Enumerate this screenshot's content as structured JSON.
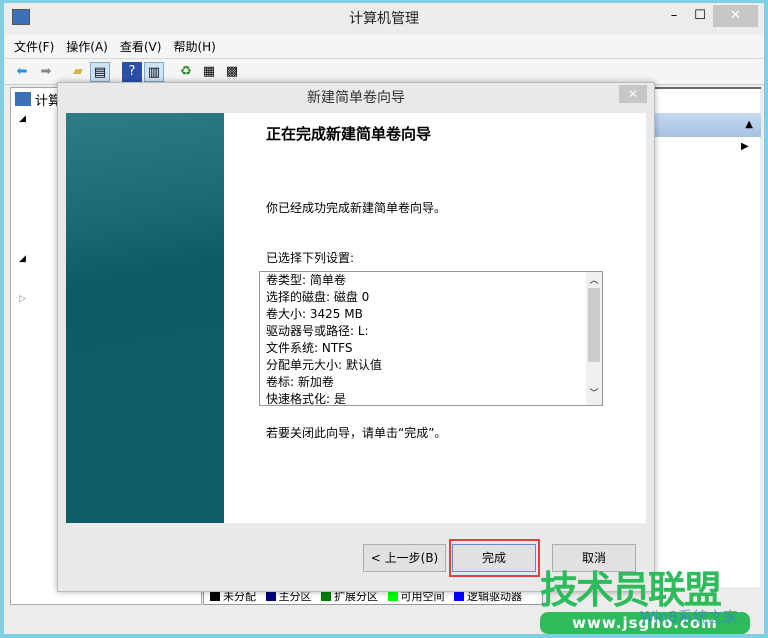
{
  "window": {
    "title": "计算机管理",
    "minimize": "–",
    "maximize": "☐",
    "close": "✕"
  },
  "menu": [
    "文件(F)",
    "操作(A)",
    "查看(V)",
    "帮助(H)"
  ],
  "tree": {
    "root": "计算"
  },
  "dialog": {
    "title": "新建简单卷向导",
    "close": "✕",
    "heading": "正在完成新建简单卷向导",
    "intro": "你已经成功完成新建简单卷向导。",
    "settings_label": "已选择下列设置:",
    "settings": [
      "卷类型: 简单卷",
      "选择的磁盘: 磁盘 0",
      "卷大小: 3425 MB",
      "驱动器号或路径: L:",
      "文件系统: NTFS",
      "分配单元大小: 默认值",
      "卷标: 新加卷",
      "快速格式化: 是"
    ],
    "close_hint": "若要关闭此向导，请单击“完成”。",
    "back": "< 上一步(B)",
    "finish": "完成",
    "cancel": "取消"
  },
  "legend": [
    {
      "label": "未分配",
      "color": "#000000"
    },
    {
      "label": "主分区",
      "color": "#000080"
    },
    {
      "label": "扩展分区",
      "color": "#008000"
    },
    {
      "label": "可用空间",
      "color": "#00ff00"
    },
    {
      "label": "逻辑驱动器",
      "color": "#0000ff"
    }
  ],
  "watermark": {
    "brand": "技术员联盟",
    "url": "www.jsgho.com",
    "sub": "Win8系统之家"
  }
}
